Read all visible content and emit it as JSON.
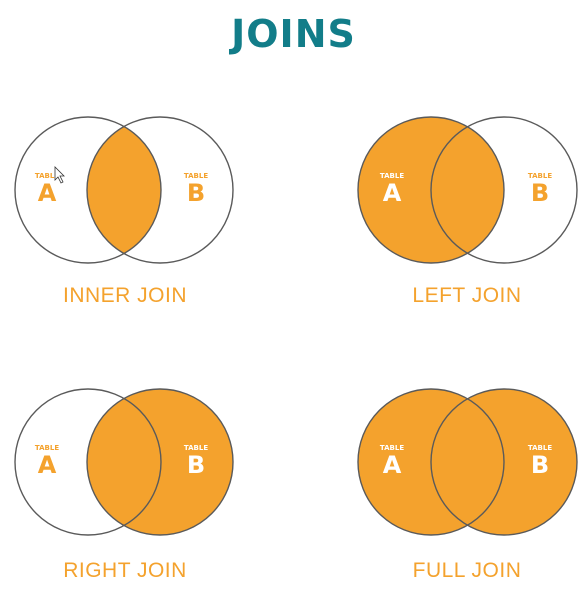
{
  "title": "JOINS",
  "colors": {
    "title": "#127d89",
    "fill": "#f4a22d",
    "stroke": "#5a5a5a",
    "label_on_white": "#f4a22d",
    "label_on_fill": "#ffffff",
    "caption": "#f4a22d"
  },
  "joins": [
    {
      "name": "INNER JOIN",
      "fill_region": "intersection",
      "table_a": {
        "small": "TABLE",
        "letter": "A"
      },
      "table_b": {
        "small": "TABLE",
        "letter": "B"
      }
    },
    {
      "name": "LEFT JOIN",
      "fill_region": "left",
      "table_a": {
        "small": "TABLE",
        "letter": "A"
      },
      "table_b": {
        "small": "TABLE",
        "letter": "B"
      }
    },
    {
      "name": "RIGHT JOIN",
      "fill_region": "right",
      "table_a": {
        "small": "TABLE",
        "letter": "A"
      },
      "table_b": {
        "small": "TABLE",
        "letter": "B"
      }
    },
    {
      "name": "FULL JOIN",
      "fill_region": "both",
      "table_a": {
        "small": "TABLE",
        "letter": "A"
      },
      "table_b": {
        "small": "TABLE",
        "letter": "B"
      }
    }
  ]
}
